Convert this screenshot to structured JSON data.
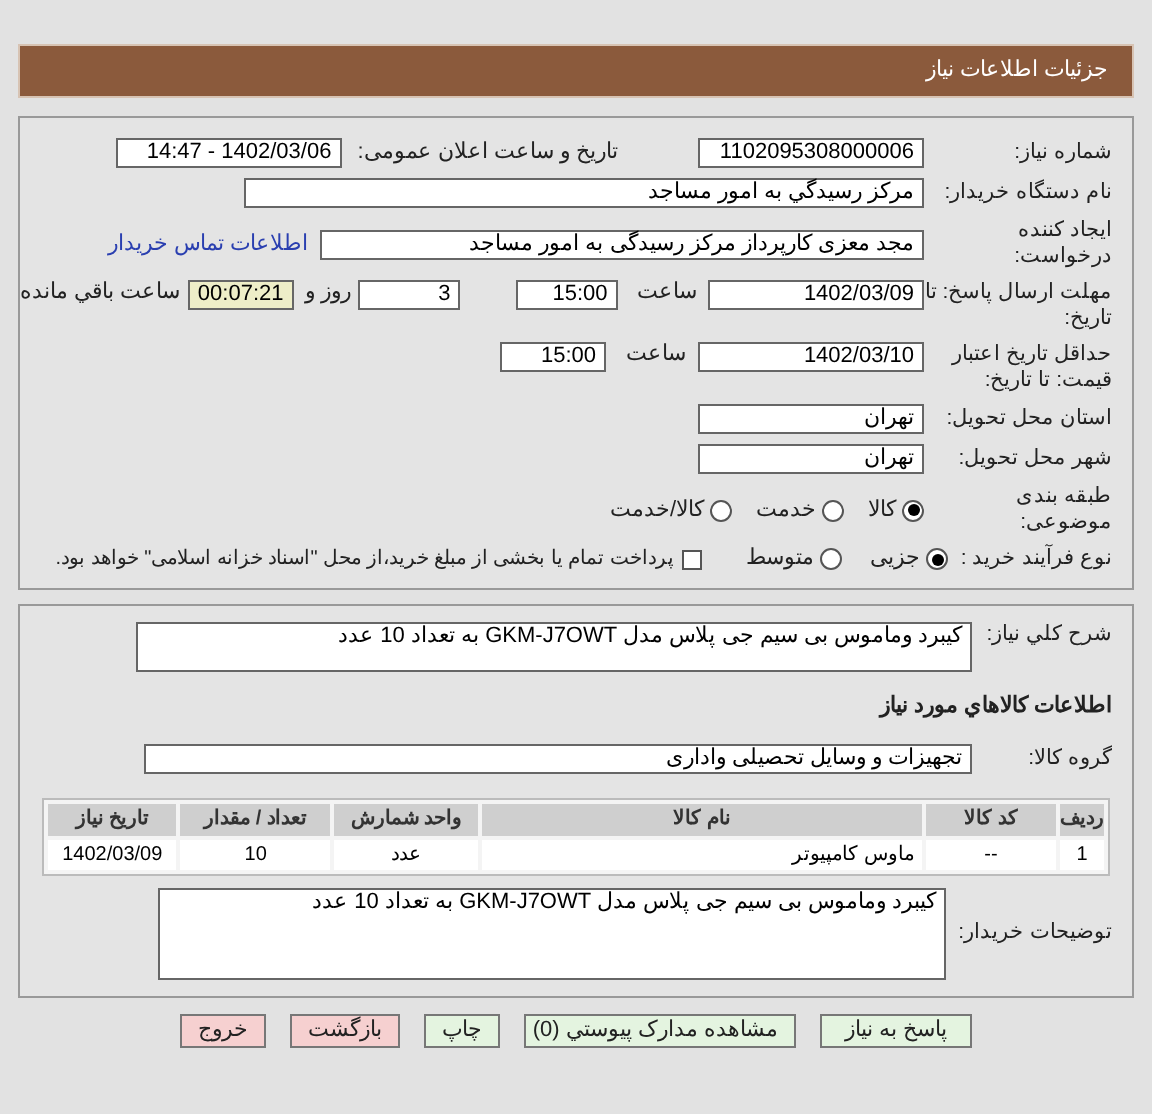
{
  "header": {
    "title": "جزئیات اطلاعات نیاز"
  },
  "need_number": {
    "label": "شماره نیاز:",
    "value": "1102095308000006"
  },
  "announce": {
    "label": "تاریخ و ساعت اعلان عمومی:",
    "value": "1402/03/06 - 14:47"
  },
  "buyer": {
    "label": "نام دستگاه خریدار:",
    "value": "مرکز رسیدگي به امور مساجد"
  },
  "requester": {
    "label": "ایجاد کننده درخواست:",
    "value": "مجد معزی کارپرداز مرکز رسیدگی به امور مساجد",
    "link": "اطلاعات تماس خریدار"
  },
  "deadline": {
    "label": "مهلت ارسال پاسخ: تا تاریخ:",
    "date": "1402/03/09",
    "time_label": "ساعت",
    "time": "15:00",
    "days": "3",
    "days_label": "روز و",
    "remaining": "00:07:21",
    "remaining_label": "ساعت باقي مانده"
  },
  "validity": {
    "label": "حداقل تاریخ اعتبار قیمت: تا تاریخ:",
    "date": "1402/03/10",
    "time_label": "ساعت",
    "time": "15:00"
  },
  "province": {
    "label": "استان محل تحویل:",
    "value": "تهران"
  },
  "city": {
    "label": "شهر محل تحویل:",
    "value": "تهران"
  },
  "category": {
    "label": "طبقه بندی موضوعی:",
    "options": [
      {
        "label": "کالا",
        "selected": true
      },
      {
        "label": "خدمت",
        "selected": false
      },
      {
        "label": "کالا/خدمت",
        "selected": false
      }
    ]
  },
  "process": {
    "label": "نوع فرآیند خرید :",
    "options": [
      {
        "label": "جزیی",
        "selected": true
      },
      {
        "label": "متوسط",
        "selected": false
      }
    ],
    "payment": {
      "label": "پرداخت تمام یا بخشی از مبلغ خرید،از محل \"اسناد خزانه اسلامی\" خواهد بود.",
      "checked": false
    }
  },
  "summary": {
    "label": "شرح کلي نياز:",
    "value": "کیبرد وماموس بی سیم جی پلاس مدل GKM-J7OWT به تعداد 10 عدد"
  },
  "goods_heading": "اطلاعات کالاهاي مورد نياز",
  "goods_group": {
    "label": "گروه کالا:",
    "value": "تجهیزات و وسایل تحصیلی واداری"
  },
  "table": {
    "columns": [
      "رديف",
      "کد کالا",
      "نام کالا",
      "واحد شمارش",
      "تعداد / مقدار",
      "تاریخ نیاز"
    ],
    "rows": [
      [
        "1",
        "--",
        "ماوس کامپیوتر",
        "عدد",
        "10",
        "1402/03/09"
      ]
    ]
  },
  "buyer_notes": {
    "label": "توضیحات خریدار:",
    "value": "کیبرد وماموس بی سیم جی پلاس مدل GKM-J7OWT به تعداد 10 عدد"
  },
  "buttons": [
    {
      "label": "پاسخ به نیاز",
      "kind": "action"
    },
    {
      "label": "مشاهده مدارک پیوستي (0)",
      "kind": "action"
    },
    {
      "label": "چاپ",
      "kind": "action"
    },
    {
      "label": "بازگشت",
      "kind": "exit"
    },
    {
      "label": "خروج",
      "kind": "exit"
    }
  ]
}
